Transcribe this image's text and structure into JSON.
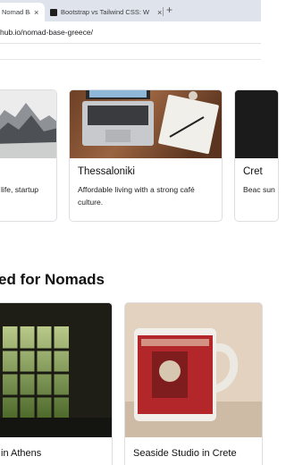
{
  "browser": {
    "tabs": [
      {
        "label": "Nomad Base Greece",
        "active": true
      },
      {
        "label": "Bootstrap vs Tailwind CSS: W",
        "active": false
      }
    ],
    "close_glyph": "×",
    "new_tab_glyph": "+",
    "url": "hub.io/nomad-base-greece/"
  },
  "top_cards": [
    {
      "title": "",
      "text": "life, startup",
      "image": "misty-mountains-photo"
    },
    {
      "title": "Thessaloniki",
      "text": "Affordable living with a strong café culture.",
      "image": "laptop-desk-photo"
    },
    {
      "title": "Cret",
      "text": "Beac sunsa",
      "image": "dark-photo"
    }
  ],
  "section": {
    "title": "ed for Nomads"
  },
  "bottom_cards": [
    {
      "title": "in Athens",
      "image": "window-greenery-photo"
    },
    {
      "title": "Seaside Studio in Crete",
      "image": "red-mug-photo"
    }
  ],
  "colors": {
    "tab_bar": "#dfe3eb",
    "border": "#dcdee2",
    "text": "#212529"
  }
}
